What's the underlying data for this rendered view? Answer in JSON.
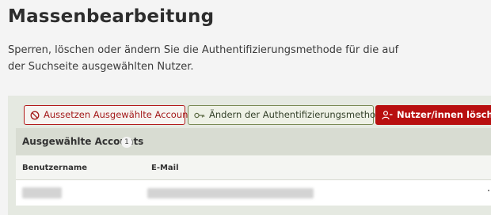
{
  "page": {
    "title": "Massenbearbeitung",
    "description": "Sperren, löschen oder ändern Sie die Authentifizierungsmethode für die auf der Suchseite ausgewählten Nutzer."
  },
  "toolbar": {
    "suspend_label": "Aussetzen Ausgewählte Accounts",
    "auth_label": "Ändern der Authentifizierungsmethode",
    "delete_label": "Nutzer/innen löschen",
    "icons": {
      "suspend": "ban-icon",
      "auth": "key-icon",
      "delete": "user-minus-icon"
    }
  },
  "selected": {
    "heading": "Ausgewählte Accounts",
    "count": "1"
  },
  "table": {
    "columns": [
      "Benutzername",
      "E-Mail"
    ]
  },
  "colors": {
    "danger": "#b80f0f",
    "panel": "#e5e9e1",
    "auth_border": "#7a8a55"
  }
}
